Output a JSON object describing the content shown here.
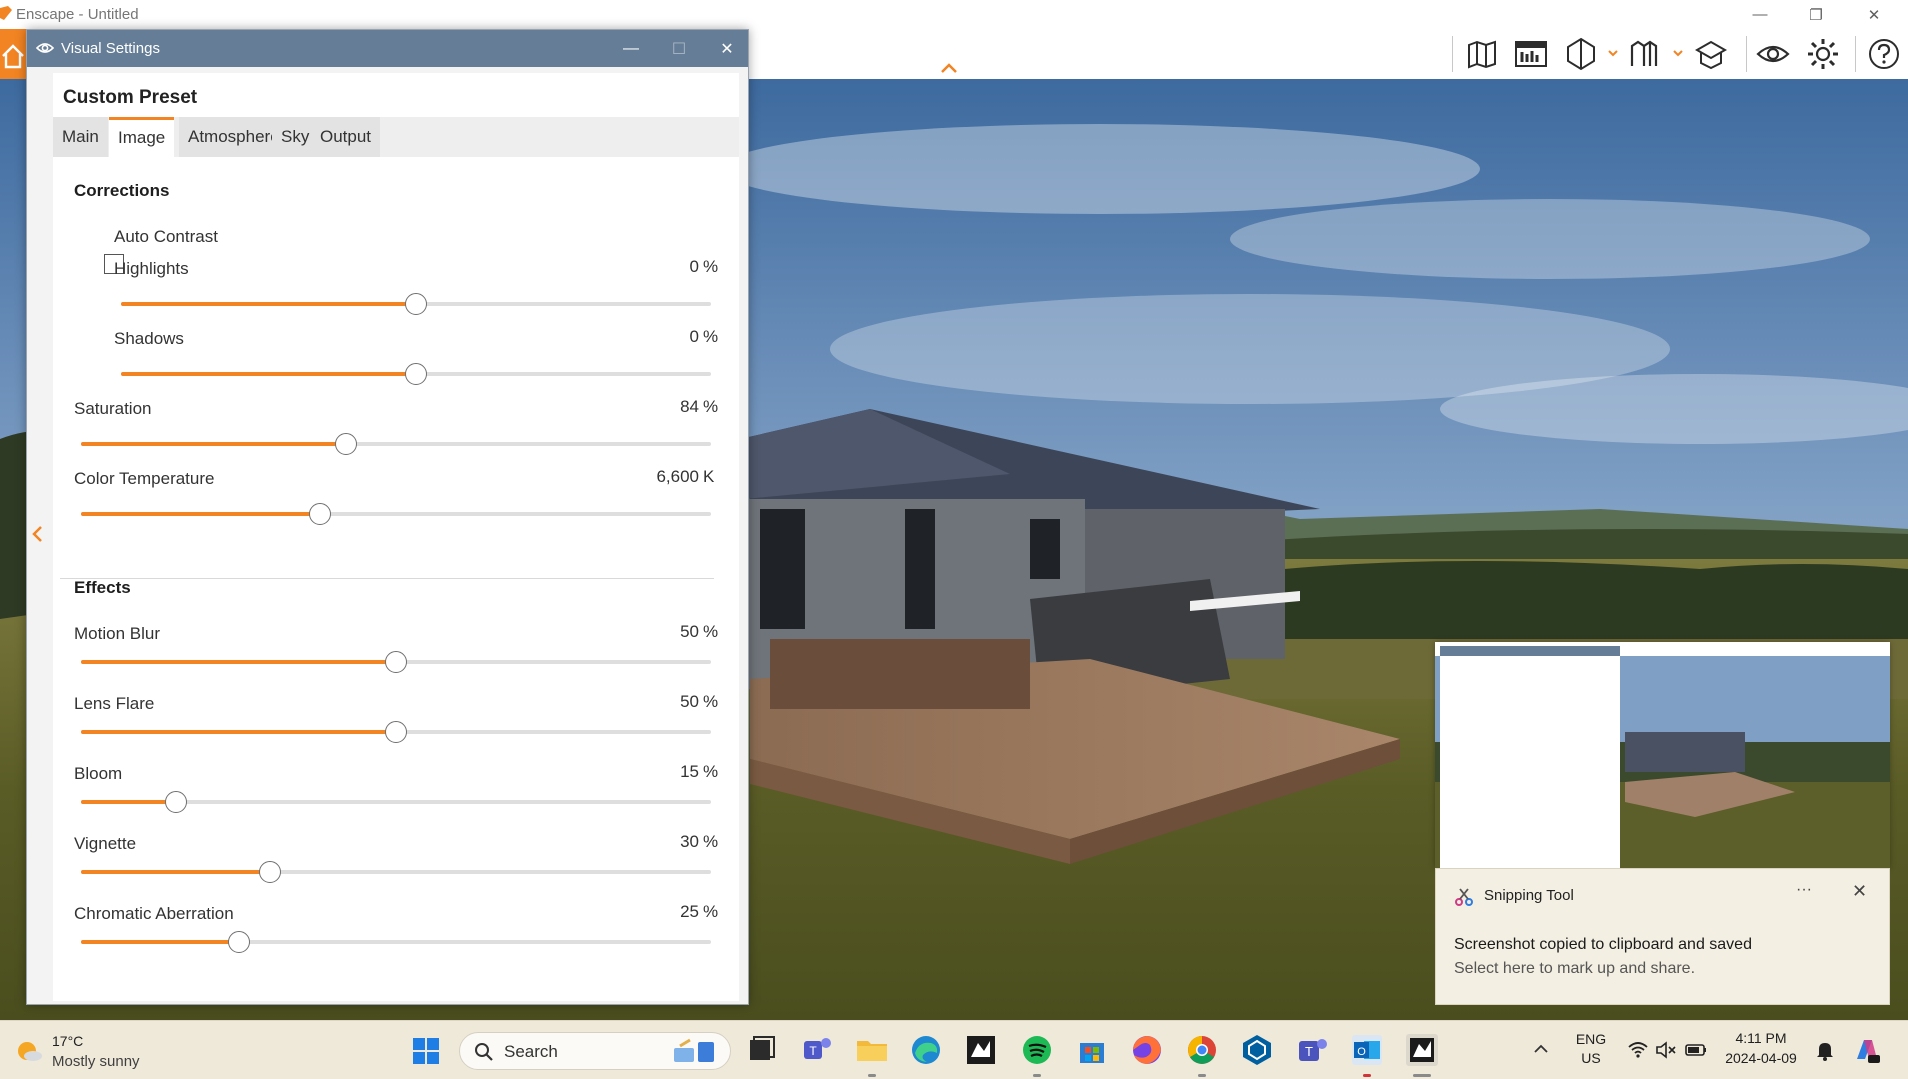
{
  "app": {
    "title": "Enscape - Untitled",
    "icons": [
      "home-icon",
      "map-icon",
      "asset-library-icon",
      "view-management-icon",
      "batch-render-icon",
      "upload-icon",
      "visual-settings-icon",
      "settings-icon",
      "help-icon"
    ]
  },
  "visual_settings": {
    "window_title": "Visual Settings",
    "preset_name": "Custom Preset",
    "tabs": [
      {
        "label": "Main",
        "active": false
      },
      {
        "label": "Image",
        "active": true
      },
      {
        "label": "Atmosphere",
        "active": false
      },
      {
        "label": "Sky",
        "active": false
      },
      {
        "label": "Output",
        "active": false
      }
    ],
    "corrections": {
      "title": "Corrections",
      "auto_contrast": {
        "label": "Auto Contrast",
        "checked": false
      },
      "highlights": {
        "label": "Highlights",
        "value": "0",
        "unit": "%",
        "fraction": 0.5
      },
      "shadows": {
        "label": "Shadows",
        "value": "0",
        "unit": "%",
        "fraction": 0.5
      },
      "saturation": {
        "label": "Saturation",
        "value": "84",
        "unit": "%",
        "fraction": 0.42
      },
      "color_temperature": {
        "label": "Color Temperature",
        "value": "6,600",
        "unit": "K",
        "fraction": 0.38
      }
    },
    "effects": {
      "title": "Effects",
      "motion_blur": {
        "label": "Motion Blur",
        "value": "50",
        "unit": "%",
        "fraction": 0.5
      },
      "lens_flare": {
        "label": "Lens Flare",
        "value": "50",
        "unit": "%",
        "fraction": 0.5
      },
      "bloom": {
        "label": "Bloom",
        "value": "15",
        "unit": "%",
        "fraction": 0.15
      },
      "vignette": {
        "label": "Vignette",
        "value": "30",
        "unit": "%",
        "fraction": 0.3
      },
      "chromatic_aberration": {
        "label": "Chromatic Aberration",
        "value": "25",
        "unit": "%",
        "fraction": 0.25
      }
    }
  },
  "notification": {
    "app_name": "Snipping Tool",
    "title": "Screenshot copied to clipboard and saved",
    "body": "Select here to mark up and share.",
    "more": "···",
    "close": "✕"
  },
  "taskbar": {
    "weather_temp": "17°C",
    "weather_desc": "Mostly sunny",
    "search_placeholder": "Search",
    "language": "ENG",
    "region": "US",
    "time": "4:11 PM",
    "date": "2024-04-09"
  },
  "colors": {
    "accent": "#f28423",
    "dialog_titlebar": "#657d96",
    "taskbar": "#efe9da"
  }
}
